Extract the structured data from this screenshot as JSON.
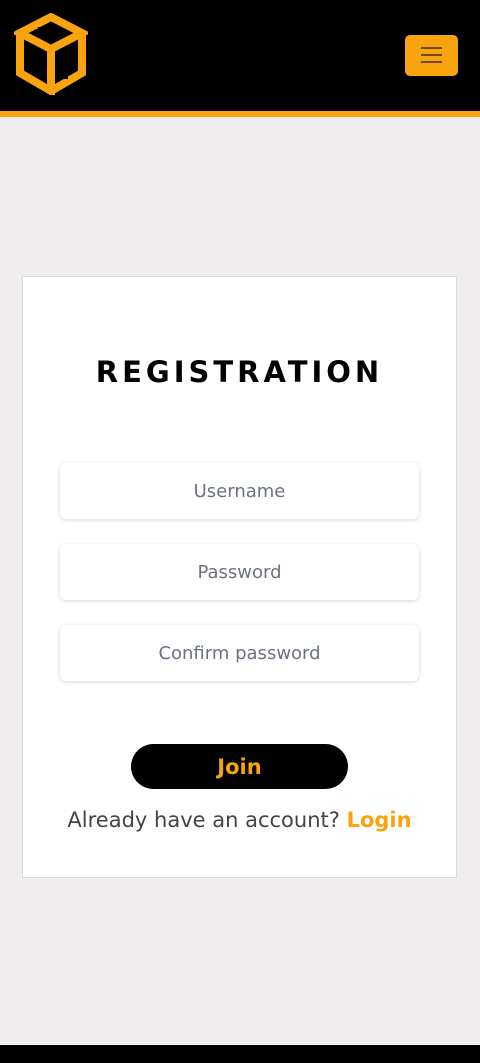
{
  "colors": {
    "accent": "#f9a30f",
    "nav_bg": "#000000",
    "page_bg": "#efedee"
  },
  "navbar": {
    "logo_icon": "cube-cg-logo",
    "menu_icon": "hamburger-menu-icon"
  },
  "form": {
    "title": "REGISTRATION",
    "username_placeholder": "Username",
    "password_placeholder": "Password",
    "confirm_placeholder": "Confirm password",
    "join_label": "Join",
    "login_prompt": "Already have an account?",
    "login_link": "Login"
  }
}
